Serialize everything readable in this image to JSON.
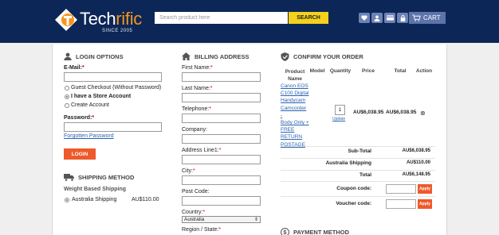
{
  "header": {
    "brand_prefix": "Tech",
    "brand_suffix": "rific",
    "since": "SINCE 2005",
    "search_placeholder": "Search product here",
    "search_button": "SEARCH",
    "cart_label": "CART",
    "icons": [
      "heart-icon",
      "user-icon",
      "card-icon",
      "lock-icon",
      "cart-icon"
    ]
  },
  "login": {
    "title": "LOGIN OPTIONS",
    "email_label": "E-Mail:",
    "options": [
      "Guest Checkout (Without Password)",
      "I have a Store Account",
      "Create Account"
    ],
    "selected_option": 1,
    "password_label": "Password:",
    "forgot": "Forgotten Password",
    "login_button": "LOGIN"
  },
  "shipping": {
    "title": "SHIPPING METHOD",
    "subtitle": "Weight Based Shipping",
    "option_label": "Australia Shipping",
    "option_price": "AU$110.00"
  },
  "billing": {
    "title": "BILLING ADDRESS",
    "fields": {
      "first_name": "First Name:",
      "last_name": "Last Name:",
      "telephone": "Telephone:",
      "company": "Company:",
      "address1": "Address Line1:",
      "city": "City:",
      "post_code": "Post Code:",
      "country": "Country:",
      "region": "Region / State:"
    },
    "country_value": "Australia"
  },
  "order": {
    "title": "CONFIRM YOUR ORDER",
    "columns": {
      "product_name": "Product Name",
      "model": "Model",
      "quantity": "Quantity",
      "price": "Price",
      "total": "Total",
      "action": "Action"
    },
    "item": {
      "name_lines": [
        "Canon EOS",
        "C100 Digital",
        "Handycam",
        "Camcorder -",
        "Body Only +",
        "FREE",
        "RETURN",
        "POSTAGE"
      ],
      "quantity": "1",
      "update": "Update",
      "price": "AU$6,038.95",
      "total": "AU$6,038.95"
    },
    "subtotal_label": "Sub-Total",
    "subtotal_value": "AU$6,038.95",
    "shipping_label": "Australia Shipping",
    "shipping_value": "AU$110.00",
    "total_label": "Total",
    "total_value": "AU$6,148.95",
    "coupon_label": "Coupon code:",
    "voucher_label": "Voucher code:",
    "apply_label": "Apply"
  },
  "payment": {
    "title": "PAYMENT METHOD"
  },
  "colors": {
    "header_bg": "#0c2757",
    "accent_orange": "#ee5a2b",
    "search_button": "#f4d21c",
    "link_blue": "#2a63b0"
  }
}
